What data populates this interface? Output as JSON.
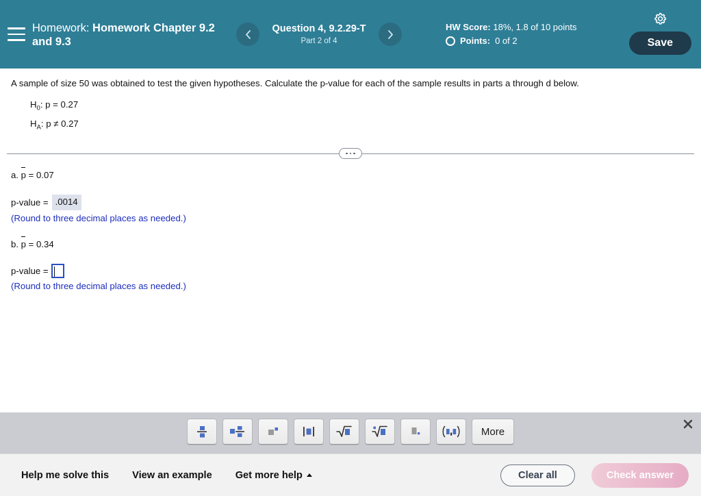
{
  "header": {
    "menu_icon": "hamburger-menu-icon",
    "homework_label": "Homework:",
    "homework_name": "Homework Chapter 9.2 and 9.3",
    "prev_icon": "chevron-left-icon",
    "next_icon": "chevron-right-icon",
    "question_number": "Question 4, 9.2.29-T",
    "question_part": "Part 2 of 4",
    "hw_score_label": "HW Score:",
    "hw_score_value": "18%, 1.8 of 10 points",
    "points_label": "Points:",
    "points_value": "0 of 2",
    "settings_icon": "gear-icon",
    "save_label": "Save",
    "bg_color": "#2e7e96",
    "save_bg_color": "#1f3a4a"
  },
  "question": {
    "prompt": "A sample of size 50 was obtained to test the given hypotheses. Calculate the p-value for each of the sample results in parts a through d below.",
    "hypotheses": [
      {
        "name": "H",
        "subscript": "0",
        "body": ": p = 0.27"
      },
      {
        "name": "H",
        "subscript": "A",
        "body": ": p ≠ 0.27"
      }
    ],
    "divider_icon": "ellipsis-collapse-icon"
  },
  "parts": [
    {
      "id": "a",
      "label_prefix": "a. ",
      "label_var": "p",
      "label_suffix": " = 0.07",
      "answer_label": "p-value =",
      "answer_value": ".0014",
      "answer_state": "filled",
      "note": "(Round to three decimal places as needed.)"
    },
    {
      "id": "b",
      "label_prefix": "b. ",
      "label_var": "p",
      "label_suffix": " = 0.34",
      "answer_label": "p-value =",
      "answer_value": "",
      "answer_state": "empty",
      "note": "(Round to three decimal places as needed.)"
    }
  ],
  "math_toolbar": {
    "bg_color": "#cbccd1",
    "close_icon": "close-icon",
    "buttons": [
      {
        "name": "fraction-icon",
        "label": ""
      },
      {
        "name": "mixed-number-icon",
        "label": ""
      },
      {
        "name": "exponent-icon",
        "label": ""
      },
      {
        "name": "absolute-value-icon",
        "label": ""
      },
      {
        "name": "square-root-icon",
        "label": ""
      },
      {
        "name": "nth-root-icon",
        "label": ""
      },
      {
        "name": "decimal-point-icon",
        "label": ""
      },
      {
        "name": "interval-notation-icon",
        "label": ""
      },
      {
        "name": "more-button",
        "label": "More"
      }
    ]
  },
  "bottom_bar": {
    "bg_color": "#f2f2f2",
    "help_me_solve": "Help me solve this",
    "view_example": "View an example",
    "get_more_help": "Get more help",
    "get_more_help_icon": "caret-up-icon",
    "clear_all": "Clear all",
    "check_answer": "Check answer",
    "check_answer_color": "#e6a9c3"
  }
}
